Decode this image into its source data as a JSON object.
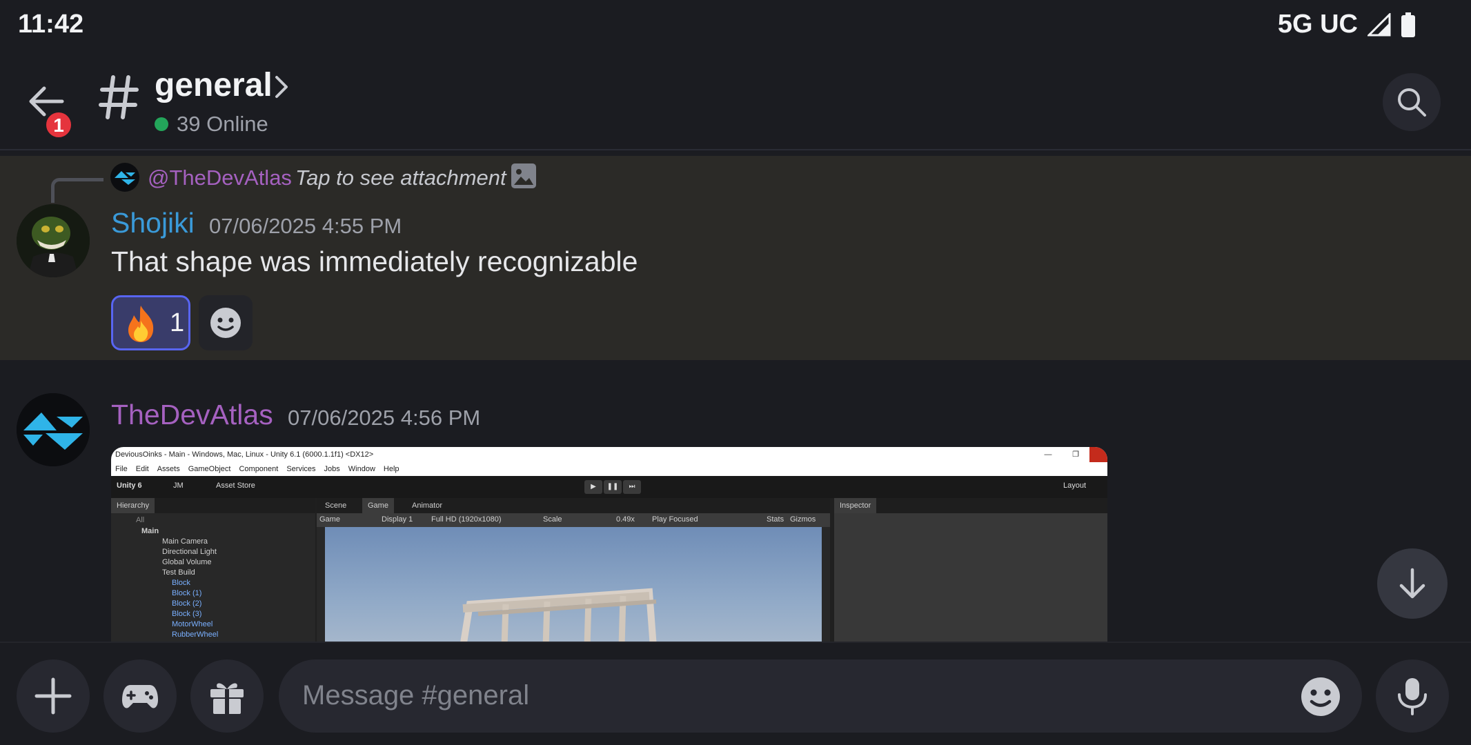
{
  "status_bar": {
    "time": "11:42",
    "network": "5G UC"
  },
  "header": {
    "back_badge": "1",
    "channel_name": "general",
    "online": "39 Online"
  },
  "messages": [
    {
      "reply": {
        "author": "@TheDevAtlas",
        "text": "Tap to see attachment"
      },
      "author": "Shojiki",
      "author_color": "#3a9ad9",
      "timestamp": "07/06/2025 4:55 PM",
      "text": "That shape was immediately recognizable",
      "reactions": [
        {
          "emoji": "fire",
          "count": "1"
        }
      ]
    },
    {
      "author": "TheDevAtlas",
      "author_color": "#a561c0",
      "timestamp": "07/06/2025 4:56 PM",
      "attachment": {
        "window_title": "DeviousOinks - Main - Windows, Mac, Linux - Unity 6.1 (6000.1.1f1) <DX12>",
        "menu": [
          "File",
          "Edit",
          "Assets",
          "GameObject",
          "Component",
          "Services",
          "Jobs",
          "Window",
          "Help"
        ],
        "toolbar": {
          "unity": "Unity 6",
          "account": "JM",
          "asset_store": "Asset Store",
          "layout": "Layout"
        },
        "hierarchy_tab": "Hierarchy",
        "search_placeholder": "All",
        "hierarchy": [
          "Main",
          "Main Camera",
          "Directional Light",
          "Global Volume",
          "Test Build",
          "Block",
          "Block (1)",
          "Block (2)",
          "Block (3)",
          "MotorWheel",
          "RubberWheel"
        ],
        "scene_tabs": [
          "Scene",
          "Game",
          "Animator"
        ],
        "game_toolbar": {
          "view": "Game",
          "display": "Display 1",
          "resolution": "Full HD (1920x1080)",
          "scale_label": "Scale",
          "scale_value": "0.49x",
          "play_mode": "Play Focused",
          "stats": "Stats",
          "gizmos": "Gizmos"
        },
        "inspector_tab": "Inspector"
      }
    }
  ],
  "composer": {
    "placeholder": "Message #general"
  },
  "colors": {
    "accent": "#5865f2",
    "online": "#23a55a",
    "badge": "#e5343d"
  }
}
